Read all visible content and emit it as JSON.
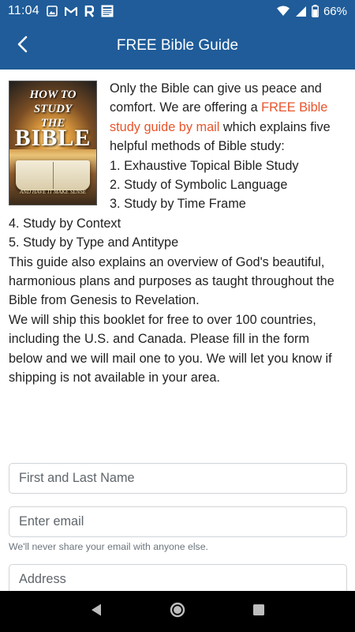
{
  "status_bar": {
    "time": "11:04",
    "battery": "66%",
    "icons": [
      "image-icon",
      "gmail-icon",
      "r-app-icon",
      "newspaper-app-icon",
      "wifi-icon",
      "signal-icon",
      "battery-icon"
    ]
  },
  "app_bar": {
    "title": "FREE Bible Guide",
    "back_icon": "back-arrow-icon"
  },
  "book_cover": {
    "title_line1": "HOW TO",
    "title_line2": "STUDY",
    "title_line3": "THE",
    "title_big": "BIBLE",
    "subtitle": "AND HAVE IT MAKE SENSE"
  },
  "intro": {
    "p1_start": "Only the Bible can give us peace and comfort. We are offering a ",
    "p1_highlight": "FREE Bible study guide by mail",
    "p1_end": " which explains five helpful methods of Bible study:",
    "methods": [
      "1. Exhaustive Topical Bible Study",
      "2. Study of Symbolic Language",
      "3. Study by Time Frame",
      "4. Study by Context",
      "5. Study by Type and Antitype"
    ],
    "p2": "This guide also explains an overview of God's beautiful, harmonious plans and purposes as taught throughout the Bible from Genesis to Revelation.",
    "p3": "We will ship this booklet for free to over 100 countries, including the U.S. and Canada. Please fill in the form below and we will mail one to you. We will let you know if shipping is not available in your area."
  },
  "form": {
    "name_placeholder": "First and Last Name",
    "name_value": "",
    "email_placeholder": "Enter email",
    "email_value": "",
    "email_help": "We'll never share your email with anyone else.",
    "address_placeholder": "Address",
    "address_value": ""
  },
  "nav_bar": {
    "buttons": [
      "back-triangle-icon",
      "home-circle-icon",
      "recents-square-icon"
    ]
  },
  "colors": {
    "primary": "#1f5c99",
    "accent": "#e8542b",
    "nav_bg": "#000000"
  }
}
